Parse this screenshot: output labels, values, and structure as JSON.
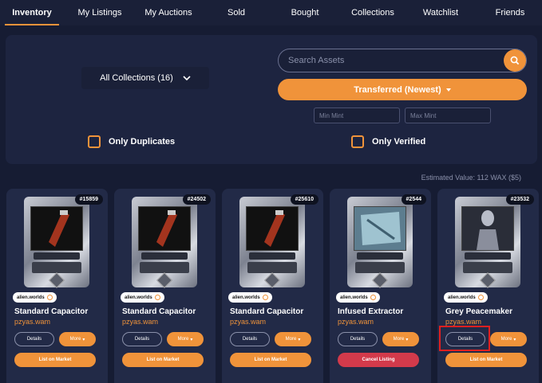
{
  "tabs": [
    "Inventory",
    "My Listings",
    "My Auctions",
    "Sold",
    "Bought",
    "Collections",
    "Watchlist",
    "Friends"
  ],
  "filters": {
    "collection_select": "All Collections (16)",
    "search_placeholder": "Search Assets",
    "sort_label": "Transferred (Newest)",
    "min_mint_placeholder": "Min Mint",
    "max_mint_placeholder": "Max Mint",
    "only_duplicates": "Only Duplicates",
    "only_verified": "Only Verified"
  },
  "estimated_value": "Estimated Value: 112 WAX ($5)",
  "cards": [
    {
      "mint": "#15859",
      "collection": "alien.worlds",
      "name": "Standard Capacitor",
      "owner": "pzyas.wam",
      "details": "Details",
      "more": "More",
      "action": "List on Market"
    },
    {
      "mint": "#24502",
      "collection": "alien.worlds",
      "name": "Standard Capacitor",
      "owner": "pzyas.wam",
      "details": "Details",
      "more": "More",
      "action": "List on Market"
    },
    {
      "mint": "#25610",
      "collection": "alien.worlds",
      "name": "Standard Capacitor",
      "owner": "pzyas.wam",
      "details": "Details",
      "more": "More",
      "action": "List on Market"
    },
    {
      "mint": "#2544",
      "collection": "alien.worlds",
      "name": "Infused Extractor",
      "owner": "pzyas.wam",
      "details": "Details",
      "more": "More",
      "action": "Cancel Listing"
    },
    {
      "mint": "#23532",
      "collection": "alien.worlds",
      "name": "Grey Peacemaker",
      "owner": "pzyas.wam",
      "details": "Details",
      "more": "More",
      "action": "List on Market"
    }
  ],
  "colors": {
    "accent": "#f0933a",
    "cancel": "#d33a4b",
    "background": "#161c33"
  }
}
